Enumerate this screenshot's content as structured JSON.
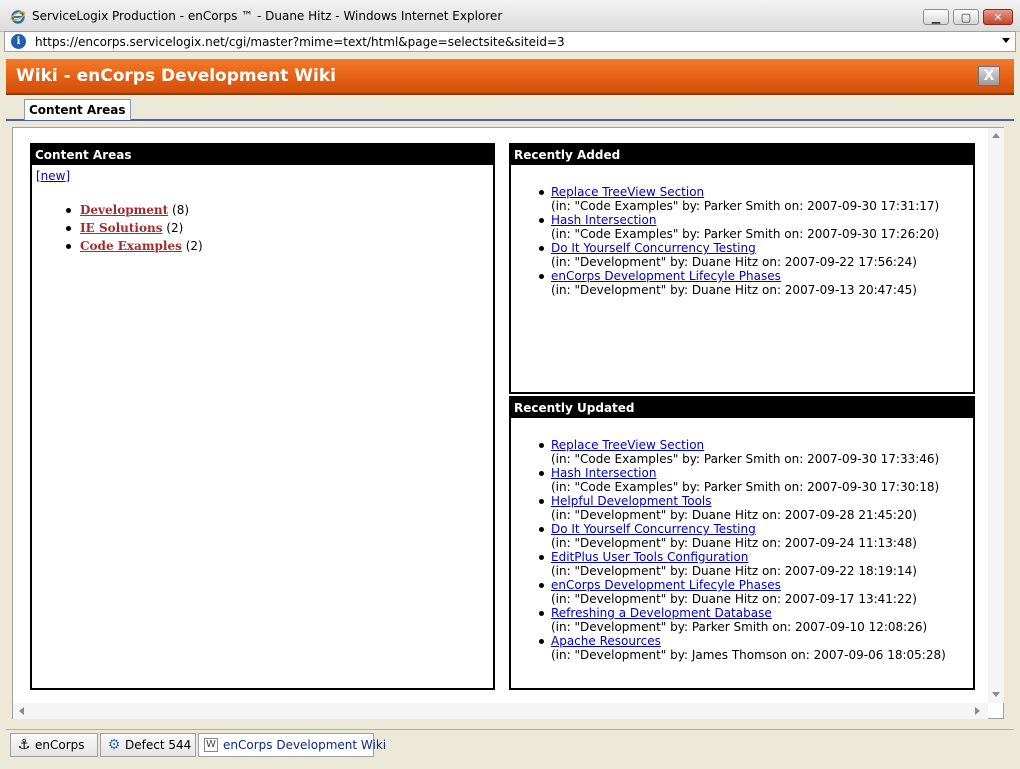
{
  "window": {
    "title": "ServiceLogix Production - enCorps ™ - Duane Hitz - Windows Internet Explorer",
    "url": "https://encorps.servicelogix.net/cgi/master?mime=text/html&page=selectsite&siteid=3",
    "min_glyph": "▁",
    "max_glyph": "▢",
    "close_glyph": "✕"
  },
  "header": {
    "title": "Wiki - enCorps Development Wiki",
    "close_label": "X"
  },
  "tabs": [
    {
      "label": "Content Areas"
    }
  ],
  "content_areas": {
    "heading": "Content Areas",
    "new_label": "[new]",
    "items": [
      {
        "name": "Development",
        "count": " (8)"
      },
      {
        "name": "IE Solutions",
        "count": " (2)"
      },
      {
        "name": "Code Examples",
        "count": " (2)"
      }
    ]
  },
  "recently_added": {
    "heading": "Recently Added",
    "items": [
      {
        "title": "Replace TreeView Section",
        "meta": "(in: \"Code Examples\" by: Parker Smith on: 2007-09-30 17:31:17)"
      },
      {
        "title": "Hash Intersection",
        "meta": "(in: \"Code Examples\" by: Parker Smith on: 2007-09-30 17:26:20)"
      },
      {
        "title": "Do It Yourself Concurrency Testing",
        "meta": "(in: \"Development\" by: Duane Hitz on: 2007-09-22 17:56:24)"
      },
      {
        "title": "enCorps Development Lifecyle Phases",
        "meta": "(in: \"Development\" by: Duane Hitz on: 2007-09-13 20:47:45)"
      }
    ]
  },
  "recently_updated": {
    "heading": "Recently Updated",
    "items": [
      {
        "title": "Replace TreeView Section",
        "meta": "(in: \"Code Examples\" by: Parker Smith on: 2007-09-30 17:33:46)"
      },
      {
        "title": "Hash Intersection",
        "meta": "(in: \"Code Examples\" by: Parker Smith on: 2007-09-30 17:30:18)"
      },
      {
        "title": "Helpful Development Tools",
        "meta": "(in: \"Development\" by: Duane Hitz on: 2007-09-28 21:45:20)"
      },
      {
        "title": "Do It Yourself Concurrency Testing",
        "meta": "(in: \"Development\" by: Duane Hitz on: 2007-09-24 11:13:48)"
      },
      {
        "title": "EditPlus User Tools Configuration",
        "meta": "(in: \"Development\" by: Duane Hitz on: 2007-09-22 18:19:14)"
      },
      {
        "title": "enCorps Development Lifecyle Phases",
        "meta": "(in: \"Development\" by: Duane Hitz on: 2007-09-17 13:41:22)"
      },
      {
        "title": "Refreshing a Development Database",
        "meta": "(in: \"Development\" by: Parker Smith on: 2007-09-10 12:08:26)"
      },
      {
        "title": "Apache Resources",
        "meta": "(in: \"Development\" by: James Thomson on: 2007-09-06 18:05:28)"
      }
    ]
  },
  "taskbar": {
    "items": [
      {
        "label": "enCorps",
        "icon": "anchor-icon",
        "glyph": "⚓"
      },
      {
        "label": "Defect 544",
        "icon": "gear-icon",
        "glyph": "⚙"
      },
      {
        "label": "enCorps Development Wiki",
        "icon": "wiki-icon",
        "glyph": "W"
      }
    ]
  },
  "colors": {
    "header_orange": "#e25d12",
    "link_blue": "#0000cc",
    "area_link": "#a52a2a",
    "tab_rule": "#4b5ea8"
  }
}
